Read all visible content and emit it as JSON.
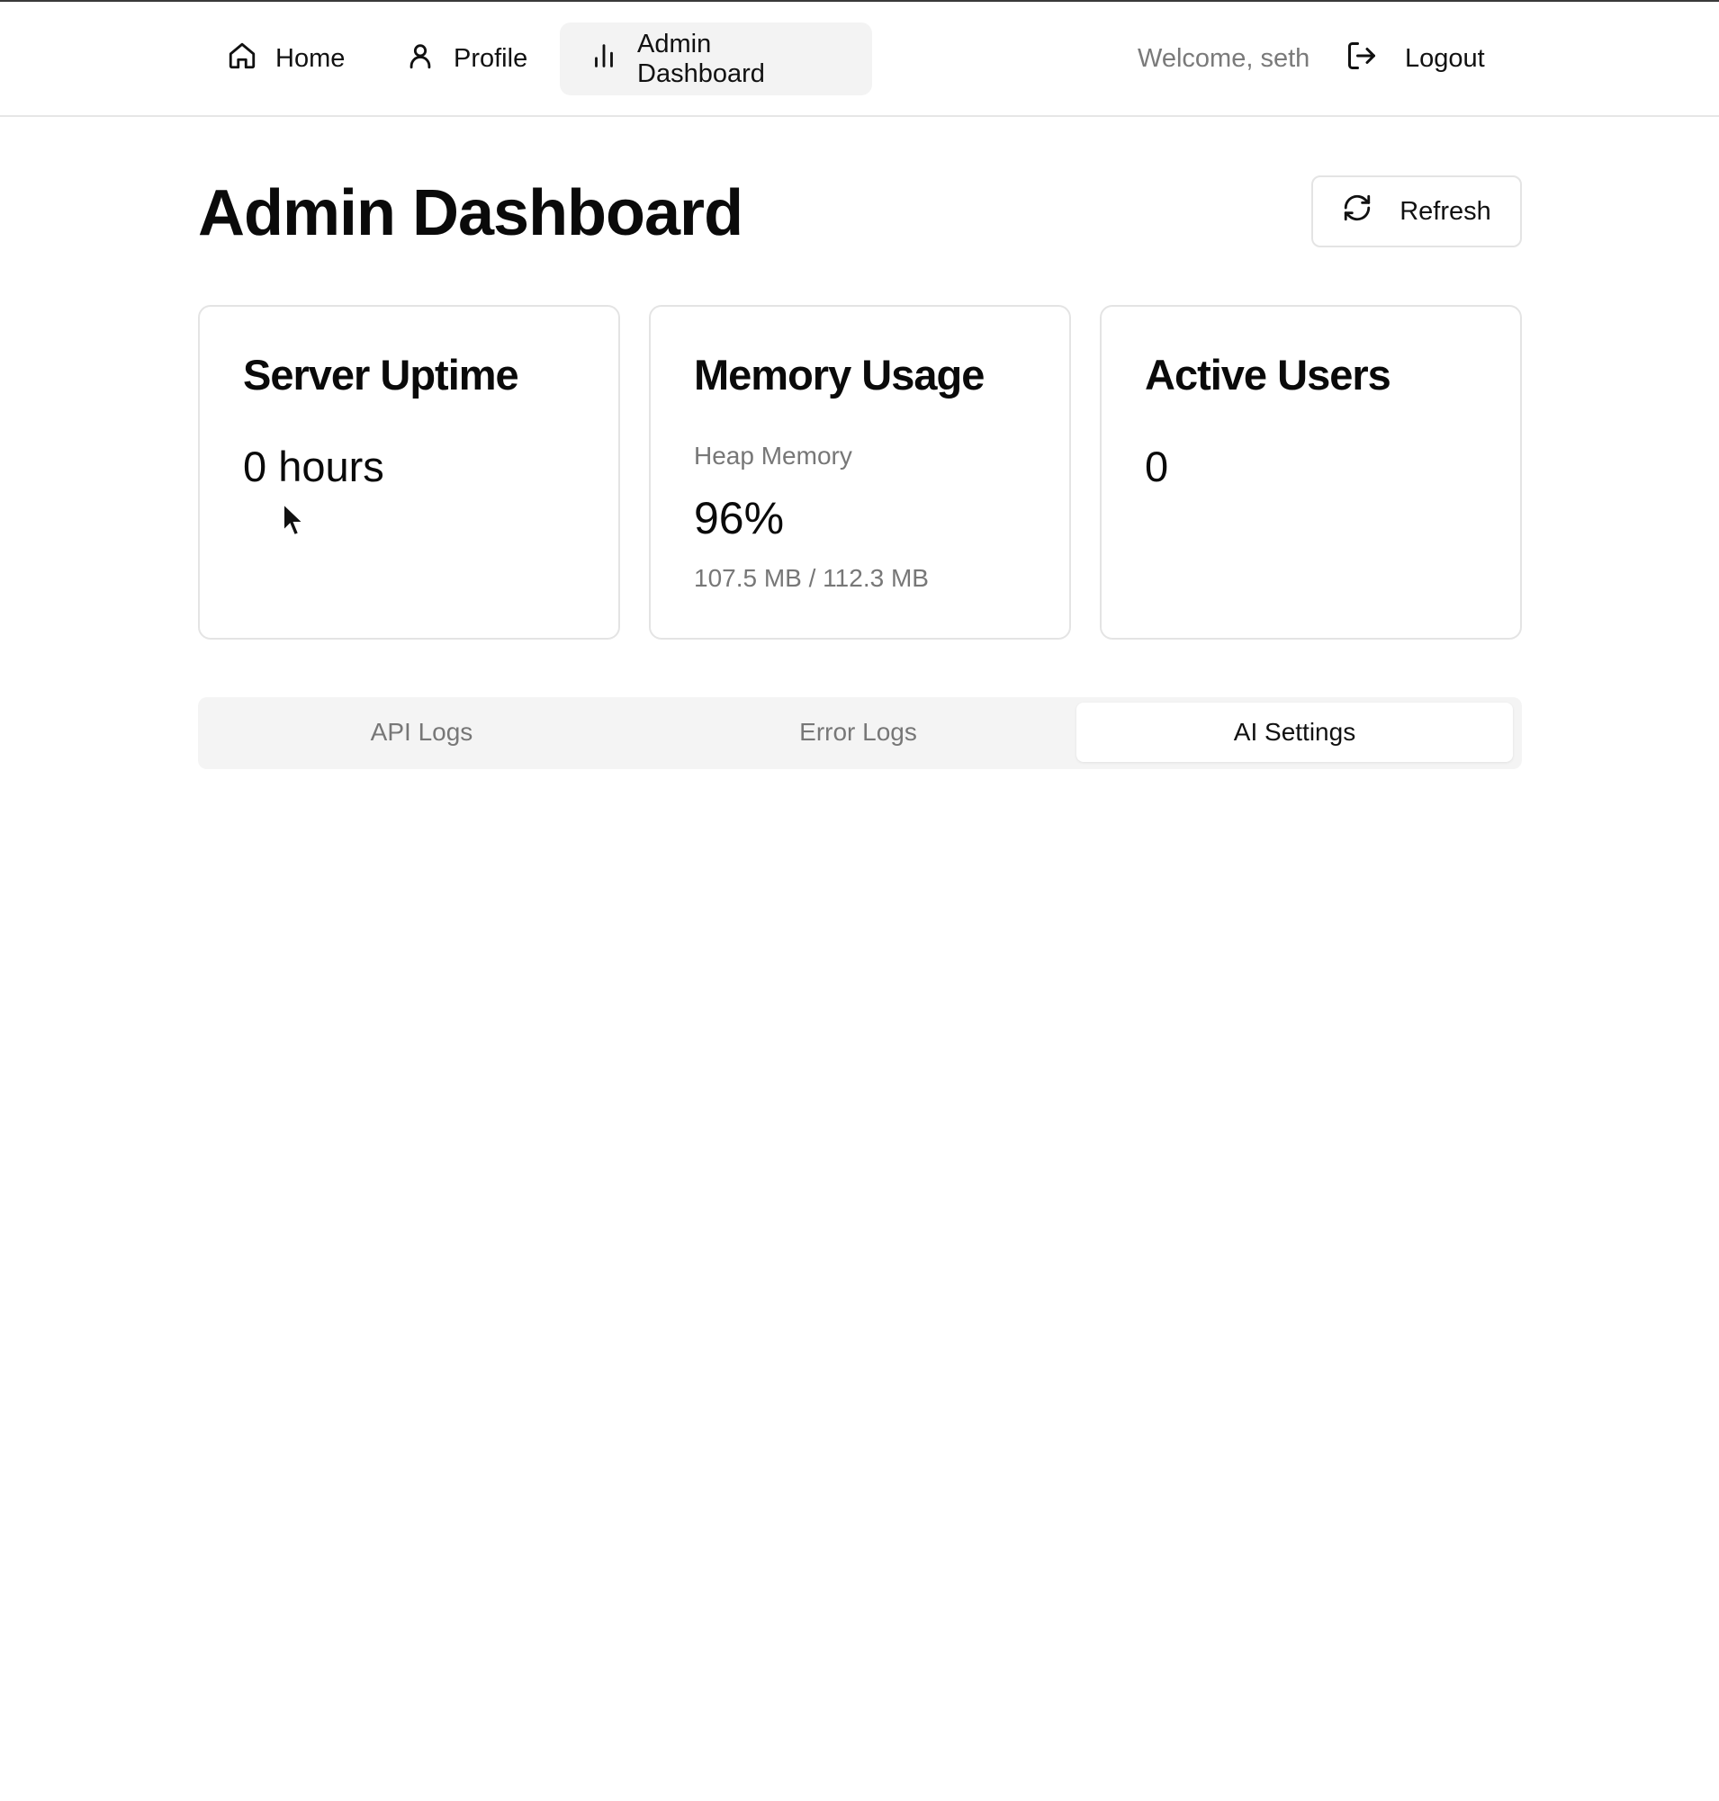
{
  "nav": {
    "items": [
      {
        "label": "Home",
        "icon": "home-icon"
      },
      {
        "label": "Profile",
        "icon": "user-icon"
      },
      {
        "label": "Admin Dashboard",
        "icon": "bar-chart-icon",
        "active": true
      }
    ],
    "welcome": "Welcome, seth",
    "logout_label": "Logout"
  },
  "page": {
    "title": "Admin Dashboard",
    "refresh_label": "Refresh"
  },
  "cards": {
    "uptime": {
      "title": "Server Uptime",
      "value": "0 hours"
    },
    "memory": {
      "title": "Memory Usage",
      "subtitle": "Heap Memory",
      "percent": "96%",
      "detail": "107.5 MB / 112.3 MB"
    },
    "users": {
      "title": "Active Users",
      "value": "0"
    }
  },
  "tabs": [
    {
      "label": "API Logs"
    },
    {
      "label": "Error Logs"
    },
    {
      "label": "AI Settings",
      "active": true
    }
  ],
  "colors": {
    "muted_text": "#777777",
    "border": "#e4e4e4",
    "active_nav_bg": "#f3f3f3"
  }
}
